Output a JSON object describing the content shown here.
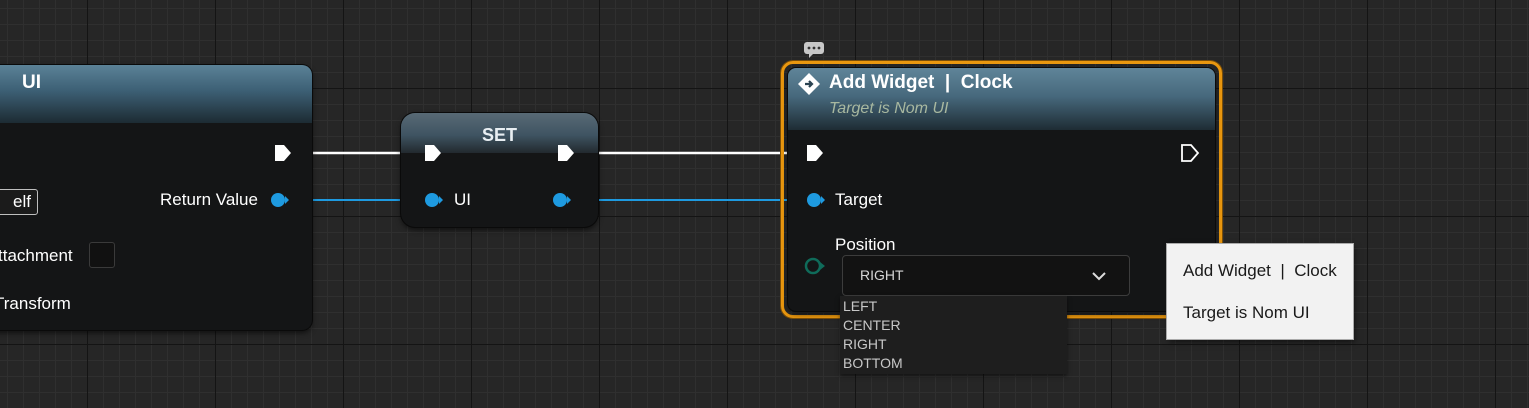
{
  "create_node": {
    "title": "UI",
    "return_value_label": "Return Value",
    "self_value": "elf",
    "attachment_label": "ttachment",
    "transform_label": "Transform"
  },
  "set_node": {
    "title": "SET",
    "ui_label": "UI"
  },
  "add_widget_node": {
    "title": "Add Widget  |  Clock",
    "subtitle": "Target is Nom UI",
    "target_label": "Target",
    "position_label": "Position",
    "position_value": "RIGHT",
    "position_options": [
      "LEFT",
      "CENTER",
      "RIGHT",
      "BOTTOM"
    ]
  },
  "tooltip": {
    "line1": "Add Widget  |  Clock",
    "line2": "Target is Nom UI"
  },
  "colors": {
    "exec_wire": "#ffffff",
    "object_wire": "#1e9ae0",
    "selection_outline": "#e9970f",
    "enum_pin": "#0f6b5a"
  }
}
